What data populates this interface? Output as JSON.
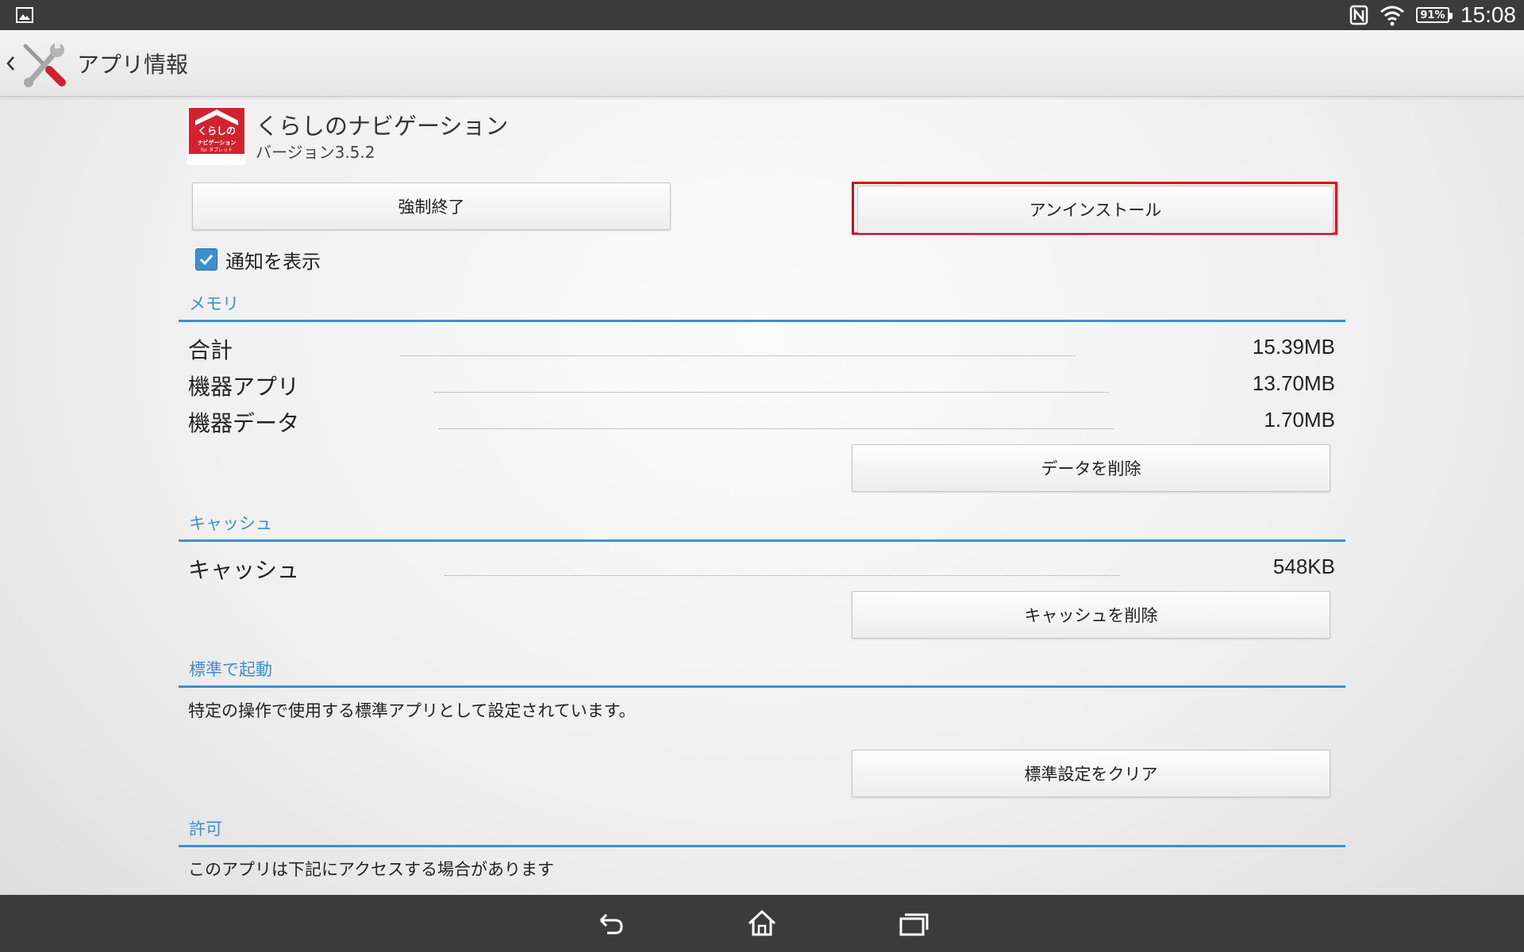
{
  "status_bar": {
    "time": "15:08",
    "battery": "91%",
    "left_icon": "image-icon",
    "icons": [
      "nfc-icon",
      "wifi-icon",
      "battery-icon"
    ]
  },
  "action_bar": {
    "title": "アプリ情報",
    "back_icon": "chevron-left-icon",
    "app_icon": "settings-tools-icon"
  },
  "app": {
    "name": "くらしのナビゲーション",
    "version": "バージョン3.5.2",
    "icon_lines": [
      "くらしの",
      "ナビゲーション",
      "for タブレット"
    ]
  },
  "buttons": {
    "force_stop": "強制終了",
    "uninstall": "アンインストール",
    "clear_data": "データを削除",
    "clear_cache": "キャッシュを削除",
    "clear_defaults": "標準設定をクリア"
  },
  "notifications": {
    "label": "通知を表示",
    "checked": true
  },
  "memory": {
    "header": "メモリ",
    "rows": [
      {
        "label": "合計",
        "value": "15.39MB"
      },
      {
        "label": "機器アプリ",
        "value": "13.70MB"
      },
      {
        "label": "機器データ",
        "value": "1.70MB"
      }
    ]
  },
  "cache": {
    "header": "キャッシュ",
    "rows": [
      {
        "label": "キャッシュ",
        "value": "548KB"
      }
    ]
  },
  "defaults": {
    "header": "標準で起動",
    "text": "特定の操作で使用する標準アプリとして設定されています。"
  },
  "permissions": {
    "header": "許可",
    "text": "このアプリは下記にアクセスする場合があります"
  },
  "colors": {
    "accent": "#3f8fcf",
    "highlight": "#e60012",
    "bar": "#3b3b3b"
  }
}
